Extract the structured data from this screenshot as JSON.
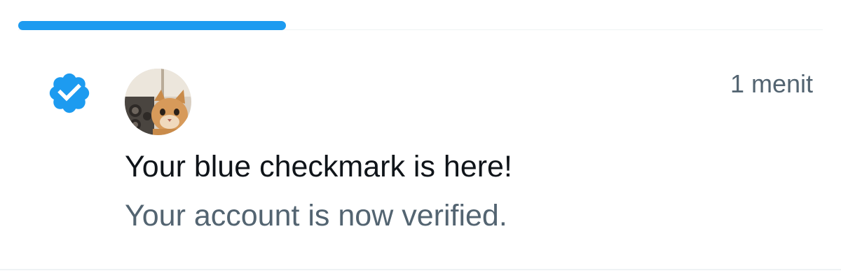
{
  "tabs": {
    "active_indicator_color": "#1d9bf0"
  },
  "notification": {
    "icon": "verified-badge-icon",
    "icon_color": "#1d9bf0",
    "avatar": "cat-avatar",
    "timestamp": "1 menit",
    "title": "Your blue checkmark is here!",
    "subtitle": "Your account is now verified."
  }
}
